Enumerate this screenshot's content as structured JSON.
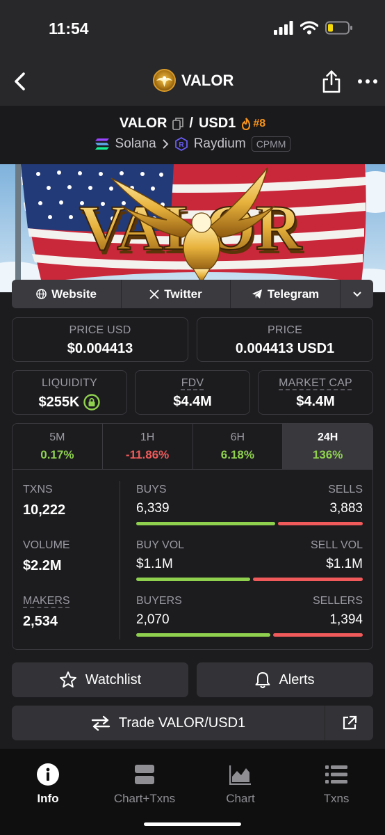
{
  "status": {
    "time": "11:54"
  },
  "nav": {
    "title": "VALOR"
  },
  "pair": {
    "base": "VALOR",
    "separator": "/",
    "quote": "USD1",
    "rank": "#8",
    "chain": "Solana",
    "dex": "Raydium",
    "pool_type": "CPMM"
  },
  "banner": {
    "text": "VALOR"
  },
  "links": {
    "website": "Website",
    "twitter": "Twitter",
    "telegram": "Telegram"
  },
  "cards": {
    "price_usd": {
      "label": "PRICE USD",
      "value": "$0.004413"
    },
    "price": {
      "label": "PRICE",
      "value": "0.004413 USD1"
    },
    "liquidity": {
      "label": "LIQUIDITY",
      "value": "$255K"
    },
    "fdv": {
      "label": "FDV",
      "value": "$4.4M"
    },
    "market_cap": {
      "label": "MARKET CAP",
      "value": "$4.4M"
    }
  },
  "timeframes": [
    {
      "label": "5M",
      "change": "0.17%"
    },
    {
      "label": "1H",
      "change": "-11.86%"
    },
    {
      "label": "6H",
      "change": "6.18%"
    },
    {
      "label": "24H",
      "change": "136%"
    }
  ],
  "stats": {
    "txns": {
      "label": "TXNS",
      "value": "10,222"
    },
    "volume": {
      "label": "VOLUME",
      "value": "$2.2M"
    },
    "makers": {
      "label": "MAKERS",
      "value": "2,534"
    },
    "buys": {
      "label": "BUYS",
      "value": "6,339",
      "ratio": 0.62
    },
    "sells": {
      "label": "SELLS",
      "value": "3,883"
    },
    "buy_vol": {
      "label": "BUY VOL",
      "value": "$1.1M",
      "ratio": 0.51
    },
    "sell_vol": {
      "label": "SELL VOL",
      "value": "$1.1M"
    },
    "buyers": {
      "label": "BUYERS",
      "value": "2,070",
      "ratio": 0.6
    },
    "sellers": {
      "label": "SELLERS",
      "value": "1,394"
    }
  },
  "actions": {
    "watchlist": "Watchlist",
    "alerts": "Alerts",
    "trade": "Trade VALOR/USD1"
  },
  "tabs": [
    {
      "label": "Info",
      "icon": "info-icon"
    },
    {
      "label": "Chart+Txns",
      "icon": "chart-txns-icon"
    },
    {
      "label": "Chart",
      "icon": "chart-icon"
    },
    {
      "label": "Txns",
      "icon": "list-icon"
    }
  ],
  "colors": {
    "positive": "#8fd14f",
    "negative": "#f05a5a",
    "rank": "#f7931a"
  }
}
